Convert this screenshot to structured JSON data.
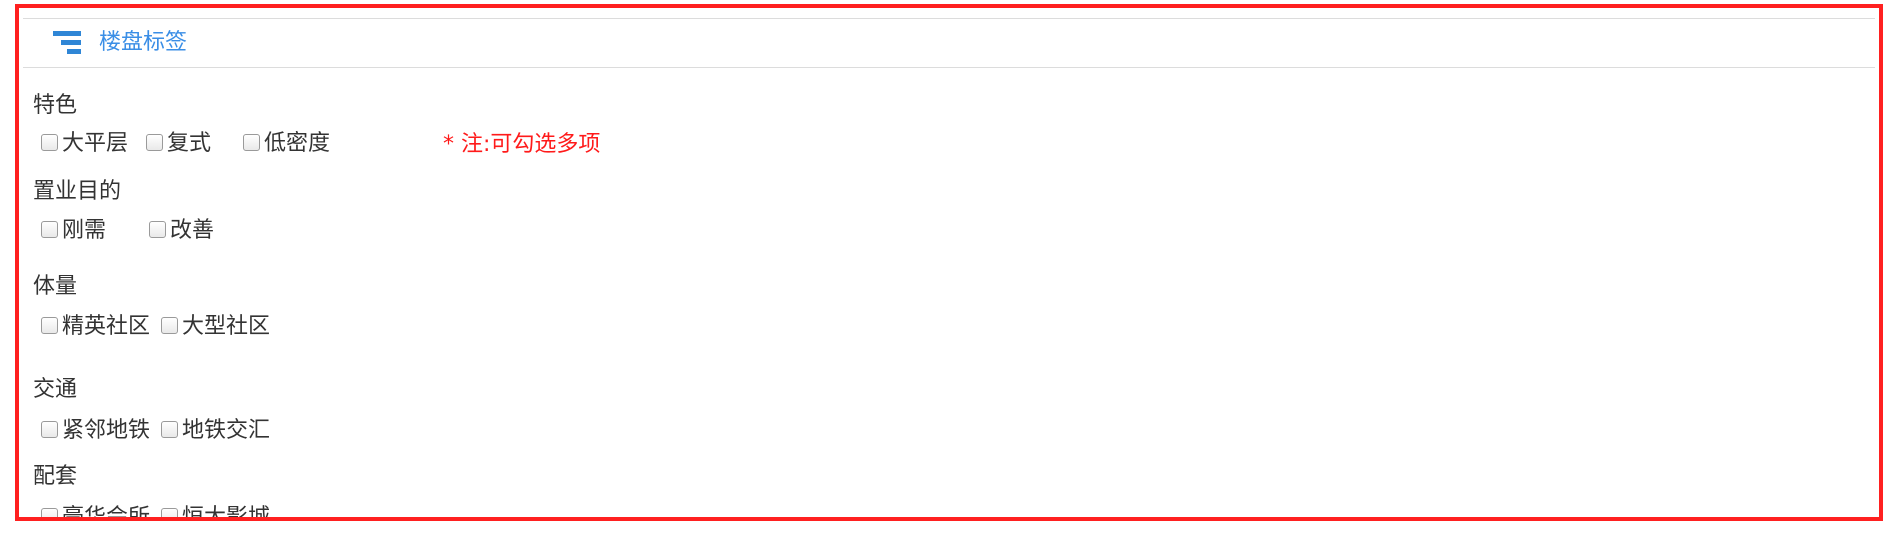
{
  "header": {
    "icon": "filter-list-icon",
    "title": "楼盘标签",
    "title_color": "#3a8ee6"
  },
  "frame_color": "#ff2020",
  "note": "* 注:可勾选多项",
  "note_color": "#ff1a1a",
  "sections": [
    {
      "label": "特色",
      "options": [
        "大平层",
        "复式",
        "低密度"
      ]
    },
    {
      "label": "置业目的",
      "options": [
        "刚需",
        "改善"
      ]
    },
    {
      "label": "体量",
      "options": [
        "精英社区",
        "大型社区"
      ]
    },
    {
      "label": "交通",
      "options": [
        "紧邻地铁",
        "地铁交汇"
      ]
    },
    {
      "label": "配套",
      "options": [
        "豪华会所",
        "恒大影城"
      ]
    }
  ]
}
